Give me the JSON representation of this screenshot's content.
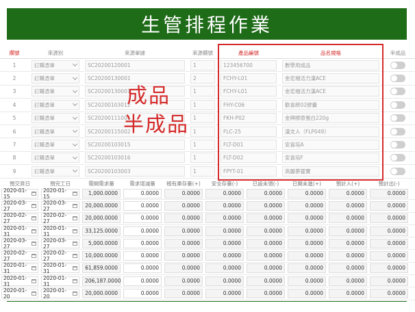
{
  "banner": {
    "title": "生管排程作業"
  },
  "colors": {
    "banner": "#1e6b18",
    "highlight": "#d42a2a"
  },
  "overlay": {
    "line1": "成品",
    "line2": "半成品"
  },
  "upper": {
    "headers": {
      "no": "欄號",
      "source_type": "來源別",
      "source_doc": "來源單據",
      "source_line": "來源欄號",
      "item_no": "產品編號",
      "item_name": "品名規格",
      "semi": "半成品"
    },
    "rows": [
      {
        "no": "1",
        "source_type": "訂購憑單",
        "doc": "SC20200120001",
        "line": "1",
        "item": "123456700",
        "name": "數學用成品"
      },
      {
        "no": "2",
        "source_type": "訂購憑單",
        "doc": "SC20200130001",
        "line": "2",
        "item": "FCHY-L01",
        "name": "金宏福活力漢ACE"
      },
      {
        "no": "3",
        "source_type": "訂購憑單",
        "doc": "SC20200130001",
        "line": "1",
        "item": "FCHY-L01",
        "name": "金宏福活力漢ACE"
      },
      {
        "no": "4",
        "source_type": "訂購憑單",
        "doc": "SC20200103012",
        "line": "1",
        "item": "FHY-C06",
        "name": "歡喜統02膠囊"
      },
      {
        "no": "5",
        "source_type": "訂購憑單",
        "doc": "SC20200111001",
        "line": "1",
        "item": "FKH-P02",
        "name": "金牌膠原蛋白220g"
      },
      {
        "no": "6",
        "source_type": "訂購憑單",
        "doc": "SC20200115002",
        "line": "1",
        "item": "FLC-25",
        "name": "漢文人（FLP049）"
      },
      {
        "no": "7",
        "source_type": "訂購憑單",
        "doc": "SC20200103015",
        "line": "1",
        "item": "FLT-D01",
        "name": "安喜培A"
      },
      {
        "no": "8",
        "source_type": "訂購憑單",
        "doc": "SC20200103016",
        "line": "1",
        "item": "FLT-D02",
        "name": "安喜培F"
      },
      {
        "no": "9",
        "source_type": "訂購憑單",
        "doc": "SC20200103003",
        "line": "1",
        "item": "FPYT-01",
        "name": "高麗蔘靈寶"
      }
    ]
  },
  "lower": {
    "headers": [
      "預交貨日",
      "預完工日",
      "需開需求量",
      "需求增減量",
      "稽有庫存量(+)",
      "安全存量(-)",
      "已設未領(-)",
      "已開未進(+)",
      "預計入(+)",
      "預計出(-)"
    ],
    "rows": [
      {
        "d1": "2020-01-15",
        "d2": "2020-01-15",
        "v": [
          "1,000.0000",
          "0.0000",
          "0.0000",
          "0.0000",
          "0.0000",
          "0.0000",
          "0.0000",
          "0.0000"
        ]
      },
      {
        "d1": "2020-03-27",
        "d2": "2020-03-27",
        "v": [
          "20,000.0000",
          "0.0000",
          "0.0000",
          "0.0000",
          "0.0000",
          "0.0000",
          "0.0000",
          "0.0000"
        ]
      },
      {
        "d1": "2020-02-27",
        "d2": "2020-02-27",
        "v": [
          "20,000.0000",
          "0.0000",
          "0.0000",
          "0.0000",
          "0.0000",
          "0.0000",
          "0.0000",
          "0.0000"
        ]
      },
      {
        "d1": "2020-01-31",
        "d2": "2020-01-31",
        "v": [
          "33,125.0000",
          "0.0000",
          "0.0000",
          "0.0000",
          "0.0000",
          "0.0000",
          "0.0000",
          "0.0000"
        ]
      },
      {
        "d1": "2020-03-27",
        "d2": "2020-03-27",
        "v": [
          "5,000.0000",
          "0.0000",
          "0.0000",
          "0.0000",
          "0.0000",
          "0.0000",
          "0.0000",
          "0.0000"
        ]
      },
      {
        "d1": "2020-02-27",
        "d2": "2020-02-27",
        "v": [
          "10,000.0000",
          "0.0000",
          "0.0000",
          "0.0000",
          "0.0000",
          "0.0000",
          "0.0000",
          "0.0000"
        ]
      },
      {
        "d1": "2020-01-31",
        "d2": "2020-01-31",
        "v": [
          "61,859.0000",
          "0.0000",
          "0.0000",
          "0.0000",
          "0.0000",
          "0.0000",
          "0.0000",
          "0.0000"
        ]
      },
      {
        "d1": "2020-01-31",
        "d2": "2020-01-31",
        "v": [
          "206,187.0000",
          "0.0000",
          "0.0000",
          "0.0000",
          "0.0000",
          "0.0000",
          "0.0000",
          "0.0000"
        ]
      },
      {
        "d1": "2020-01-20",
        "d2": "2020-01-20",
        "v": [
          "20,000.0000",
          "0.0000",
          "0.0000",
          "0.0000",
          "0.0000",
          "0.0000",
          "0.0000",
          "0.0000"
        ]
      }
    ]
  }
}
